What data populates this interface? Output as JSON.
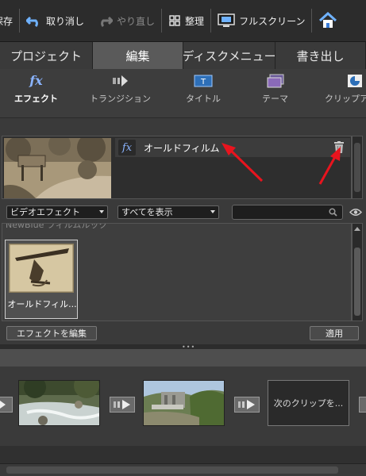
{
  "toolbar": {
    "save_label": "保存",
    "undo_label": "取り消し",
    "redo_label": "やり直し",
    "organize_label": "整理",
    "fullscreen_label": "フルスクリーン"
  },
  "tabs": [
    {
      "label": "プロジェクト"
    },
    {
      "label": "編集"
    },
    {
      "label": "ディスクメニュー"
    },
    {
      "label": "書き出し"
    }
  ],
  "subtabs": [
    {
      "label": "エフェクト"
    },
    {
      "label": "トランジション"
    },
    {
      "label": "タイトル"
    },
    {
      "label": "テーマ"
    },
    {
      "label": "クリップア"
    }
  ],
  "effect_panel": {
    "fx_label": "fx",
    "effect_name": "オールドフィルム"
  },
  "filter": {
    "category": "ビデオエフェクト",
    "show": "すべてを表示",
    "search_value": ""
  },
  "library": {
    "header": "NewBlue フィルムルック",
    "item_label": "オールドフィル..."
  },
  "buttons": {
    "edit_effect": "エフェクトを編集",
    "apply": "適用"
  },
  "timeline": {
    "next_clip_label": "次のクリップを..."
  },
  "colors": {
    "active_tab": "#5a5a5a",
    "fx_accent": "#8ab4ff",
    "annotation_arrow": "#e8141e"
  }
}
